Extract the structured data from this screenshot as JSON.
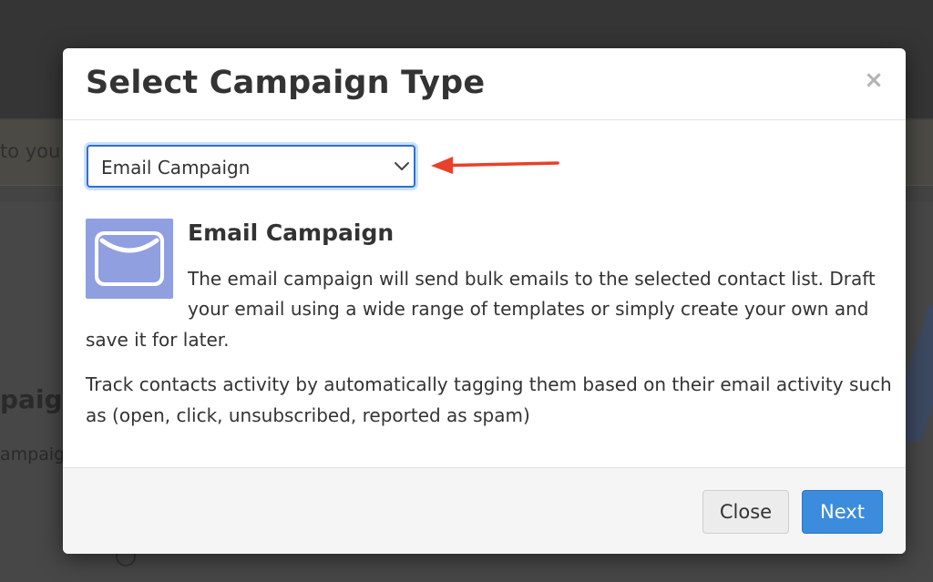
{
  "background": {
    "notice_fragment": "to you",
    "heading_fragment": "paign",
    "sub_fragment": "ampaig"
  },
  "modal": {
    "title": "Select Campaign Type",
    "close_icon": "×"
  },
  "campaign_select": {
    "selected": "Email Campaign",
    "icon": "chevron-down-icon"
  },
  "annotation": {
    "arrow_color": "#e8402a"
  },
  "campaign_info": {
    "icon": "envelope-icon",
    "icon_color": "#8f9fe0",
    "title": "Email Campaign",
    "description_lines": [
      "The email campaign will send bulk emails to the selected contact list. Draft",
      "your email using a wide range of templates or simply create your own and",
      "save it for later."
    ],
    "tracking_lines": [
      "Track contacts activity by automatically tagging them based on their email activity such",
      "as (open, click, unsubscribed, reported as spam)"
    ]
  },
  "footer": {
    "close_label": "Close",
    "next_label": "Next"
  },
  "colors": {
    "primary": "#3c8cde",
    "select_border": "#2f6fd1"
  }
}
